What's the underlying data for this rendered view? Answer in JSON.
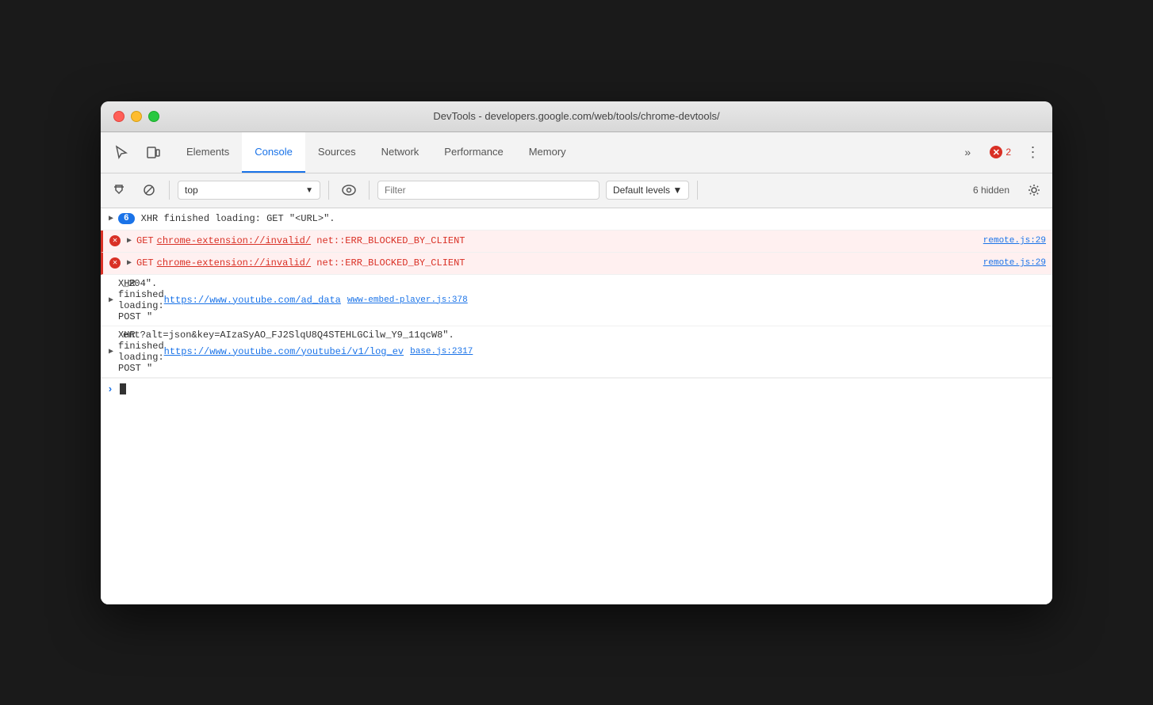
{
  "window": {
    "title": "DevTools - developers.google.com/web/tools/chrome-devtools/"
  },
  "tabs": {
    "items": [
      {
        "label": "Elements",
        "active": false
      },
      {
        "label": "Console",
        "active": true
      },
      {
        "label": "Sources",
        "active": false
      },
      {
        "label": "Network",
        "active": false
      },
      {
        "label": "Performance",
        "active": false
      },
      {
        "label": "Memory",
        "active": false
      }
    ]
  },
  "toolbar": {
    "context": "top",
    "filter_placeholder": "Filter",
    "levels_label": "Default levels ▼",
    "hidden_label": "6 hidden"
  },
  "console_entries": [
    {
      "type": "info",
      "badge": "6",
      "text": "XHR finished loading: GET \"<URL>\".",
      "source": null
    },
    {
      "type": "error",
      "text": "GET chrome-extension://invalid/ net::ERR_BLOCKED_BY_CLIENT",
      "source": "remote.js:29"
    },
    {
      "type": "error",
      "text": "GET chrome-extension://invalid/ net::ERR_BLOCKED_BY_CLIENT",
      "source": "remote.js:29"
    },
    {
      "type": "xhr",
      "text": "XHR finished loading: POST \"https://www.youtube.com/ad_data",
      "text2": "_204\".",
      "source": "www-embed-player.js:378"
    },
    {
      "type": "xhr2",
      "text": "XHR finished loading: POST \"https://www.youtube.com/youtubei/v1/log_ev",
      "text2": "ent?alt=json&key=AIzaSyAO_FJ2SlqU8Q4STEHLGCilw_Y9_11qcW8\".",
      "source": "base.js:2317"
    }
  ],
  "error_badge": {
    "count": "2"
  },
  "icons": {
    "cursor": "⌖",
    "inspect": "⬚",
    "play": "▶",
    "stop": "⊘",
    "chevron_down": "▼",
    "eye": "◉",
    "gear": "⚙",
    "more": "»",
    "kebab": "⋮"
  }
}
